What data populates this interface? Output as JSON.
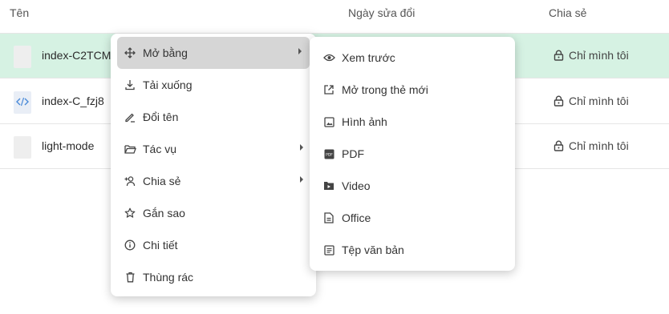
{
  "header": {
    "name": "Tên",
    "modified": "Ngày sửa đổi",
    "share": "Chia sẻ"
  },
  "files": [
    {
      "name": "index-C2TCM",
      "share": "Chỉ mình tôi"
    },
    {
      "name": "index-C_fzj8",
      "share": "Chỉ mình tôi"
    },
    {
      "name": "light-mode",
      "share": "Chỉ mình tôi"
    }
  ],
  "context_menu": {
    "items": [
      {
        "label": "Mở bằng",
        "icon": "move-icon"
      },
      {
        "label": "Tải xuống",
        "icon": "download-icon"
      },
      {
        "label": "Đổi tên",
        "icon": "rename-icon"
      },
      {
        "label": "Tác vụ",
        "icon": "folder-open-icon"
      },
      {
        "label": "Chia sẻ",
        "icon": "person-add-icon"
      },
      {
        "label": "Gắn sao",
        "icon": "star-icon"
      },
      {
        "label": "Chi tiết",
        "icon": "info-icon"
      },
      {
        "label": "Thùng rác",
        "icon": "trash-icon"
      }
    ]
  },
  "open_with_menu": {
    "items": [
      {
        "label": "Xem trước",
        "icon": "eye-icon"
      },
      {
        "label": "Mở trong thẻ mới",
        "icon": "open-new-tab-icon"
      },
      {
        "label": "Hình ảnh",
        "icon": "image-icon"
      },
      {
        "label": "PDF",
        "icon": "pdf-icon"
      },
      {
        "label": "Video",
        "icon": "video-icon"
      },
      {
        "label": "Office",
        "icon": "document-icon"
      },
      {
        "label": "Tệp văn bản",
        "icon": "text-file-icon"
      }
    ]
  }
}
